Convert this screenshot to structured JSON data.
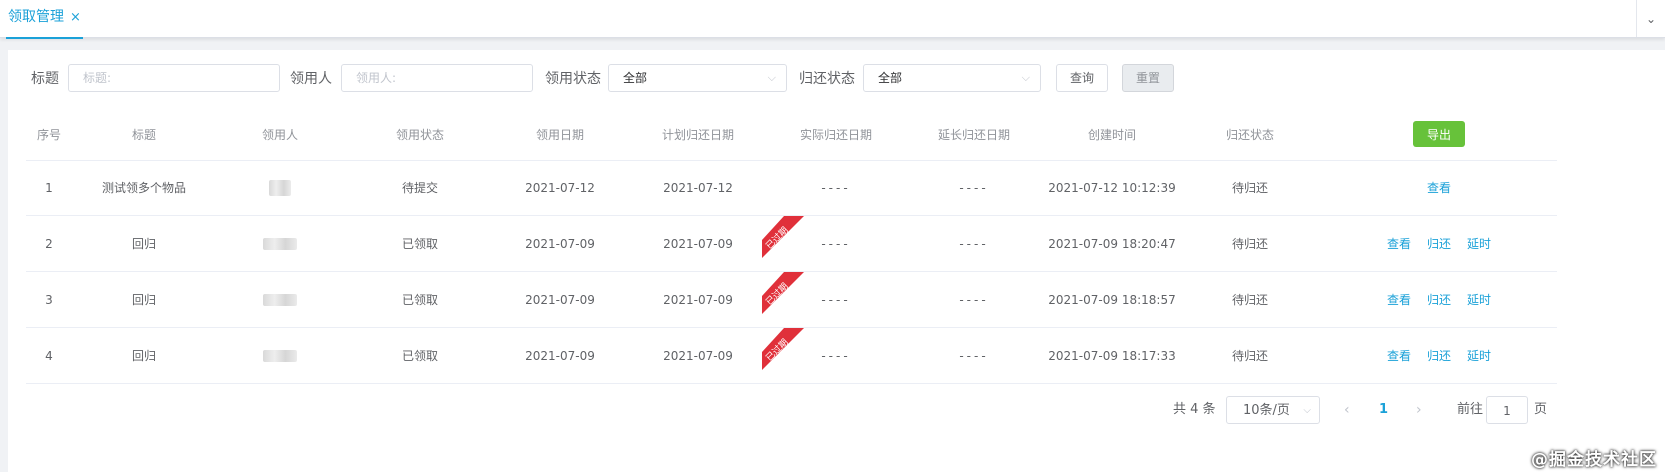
{
  "tabs": [
    {
      "label": "领取管理",
      "close": "×"
    }
  ],
  "tabbar_right_icon": "chevron-down-icon",
  "filters": {
    "title_label": "标题",
    "title_placeholder": "标题:",
    "receiver_label": "领用人",
    "receiver_placeholder": "领用人:",
    "receive_status_label": "领用状态",
    "receive_status_value": "全部",
    "return_status_label": "归还状态",
    "return_status_value": "全部",
    "query_button": "查询",
    "reset_button": "重置"
  },
  "table": {
    "columns": [
      "序号",
      "标题",
      "领用人",
      "领用状态",
      "领用日期",
      "计划归还日期",
      "实际归还日期",
      "延长归还日期",
      "创建时间",
      "归还状态"
    ],
    "export_button": "导出",
    "rows": [
      {
        "index": "1",
        "title": "测试领多个物品",
        "status": "待提交",
        "receive_date": "2021-07-12",
        "planned_return": "2021-07-12",
        "actual_return": "----",
        "extended_return": "----",
        "created": "2021-07-12 10:12:39",
        "return_status": "待归还",
        "overdue": false,
        "actions": [
          "查看"
        ]
      },
      {
        "index": "2",
        "title": "回归",
        "status": "已领取",
        "receive_date": "2021-07-09",
        "planned_return": "2021-07-09",
        "actual_return": "----",
        "extended_return": "----",
        "created": "2021-07-09 18:20:47",
        "return_status": "待归还",
        "overdue": true,
        "actions": [
          "查看",
          "归还",
          "延时"
        ]
      },
      {
        "index": "3",
        "title": "回归",
        "status": "已领取",
        "receive_date": "2021-07-09",
        "planned_return": "2021-07-09",
        "actual_return": "----",
        "extended_return": "----",
        "created": "2021-07-09 18:18:57",
        "return_status": "待归还",
        "overdue": true,
        "actions": [
          "查看",
          "归还",
          "延时"
        ]
      },
      {
        "index": "4",
        "title": "回归",
        "status": "已领取",
        "receive_date": "2021-07-09",
        "planned_return": "2021-07-09",
        "actual_return": "----",
        "extended_return": "----",
        "created": "2021-07-09 18:17:33",
        "return_status": "待归还",
        "overdue": true,
        "actions": [
          "查看",
          "归还",
          "延时"
        ]
      }
    ],
    "overdue_ribbon_label": "已过期"
  },
  "pagination": {
    "total": "共 4 条",
    "page_size": "10条/页",
    "current_page": "1",
    "goto_label": "前往",
    "goto_value": "1",
    "page_suffix": "页"
  },
  "watermark": "@掘金技术社区",
  "colors": {
    "accent": "#1ba1d8",
    "success": "#67c23a",
    "warning": "#e6a23c",
    "ribbon": "#e0303a"
  }
}
